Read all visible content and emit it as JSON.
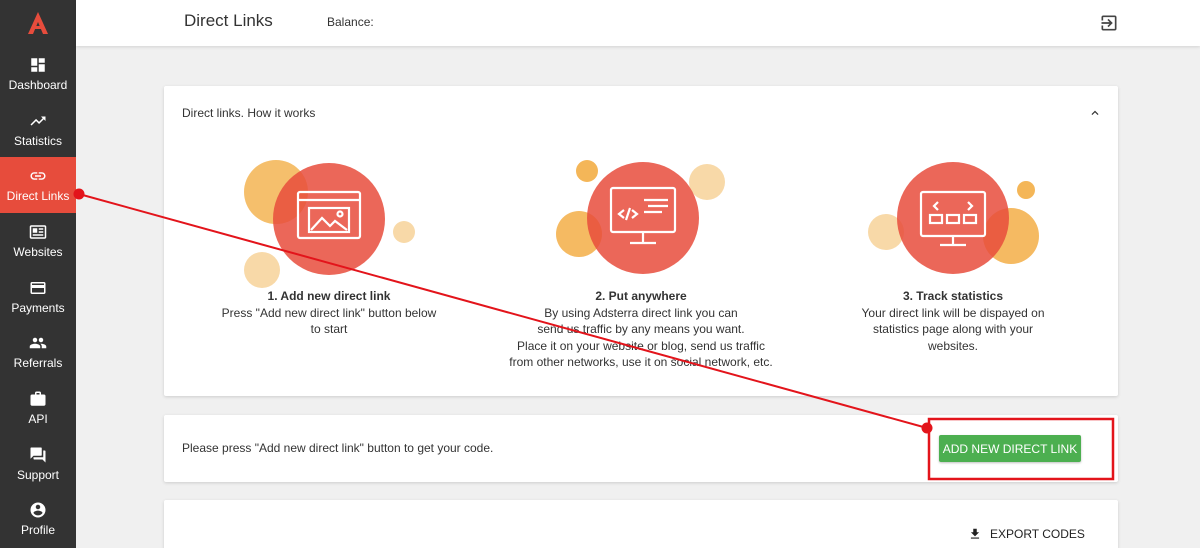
{
  "app": {
    "logo_letter": "A",
    "brand_color": "#e74c3c"
  },
  "sidebar": {
    "items": [
      {
        "label": "Dashboard",
        "icon": "dashboard-icon",
        "active": false
      },
      {
        "label": "Statistics",
        "icon": "trending-up-icon",
        "active": false
      },
      {
        "label": "Direct Links",
        "icon": "link-icon",
        "active": true
      },
      {
        "label": "Websites",
        "icon": "websites-icon",
        "active": false
      },
      {
        "label": "Payments",
        "icon": "credit-card-icon",
        "active": false
      },
      {
        "label": "Referrals",
        "icon": "people-icon",
        "active": false
      },
      {
        "label": "API",
        "icon": "briefcase-icon",
        "active": false
      },
      {
        "label": "Support",
        "icon": "chat-icon",
        "active": false
      },
      {
        "label": "Profile",
        "icon": "account-icon",
        "active": false
      }
    ]
  },
  "header": {
    "title": "Direct Links",
    "balance_label": "Balance:",
    "logout_icon": "logout-icon"
  },
  "how_it_works": {
    "title": "Direct links. How it works",
    "steps": [
      {
        "title": "1. Add new direct link",
        "lines": [
          "Press \"Add new direct link\" button below",
          "to start"
        ]
      },
      {
        "title": "2. Put anywhere",
        "lines": [
          "By using Adsterra direct link you can",
          "send us traffic by any means you want.",
          "Place it on your website or blog, send us traffic",
          "from other networks, use it on social network, etc."
        ]
      },
      {
        "title": "3. Track statistics",
        "lines": [
          "Your direct link will be dispayed on",
          "statistics page along with your",
          "websites."
        ]
      }
    ]
  },
  "action_card": {
    "text": "Please press \"Add new direct link\" button to get your code.",
    "button_label": "ADD NEW DIRECT LINK"
  },
  "export_card": {
    "label": "EXPORT CODES"
  },
  "colors": {
    "sidebar_bg": "#333333",
    "active_bg": "#e74c3c",
    "button_green": "#4caf50",
    "annotation_red": "#e3141b",
    "circle_orange": "#f2a93b",
    "circle_light": "#f8d9a8"
  }
}
